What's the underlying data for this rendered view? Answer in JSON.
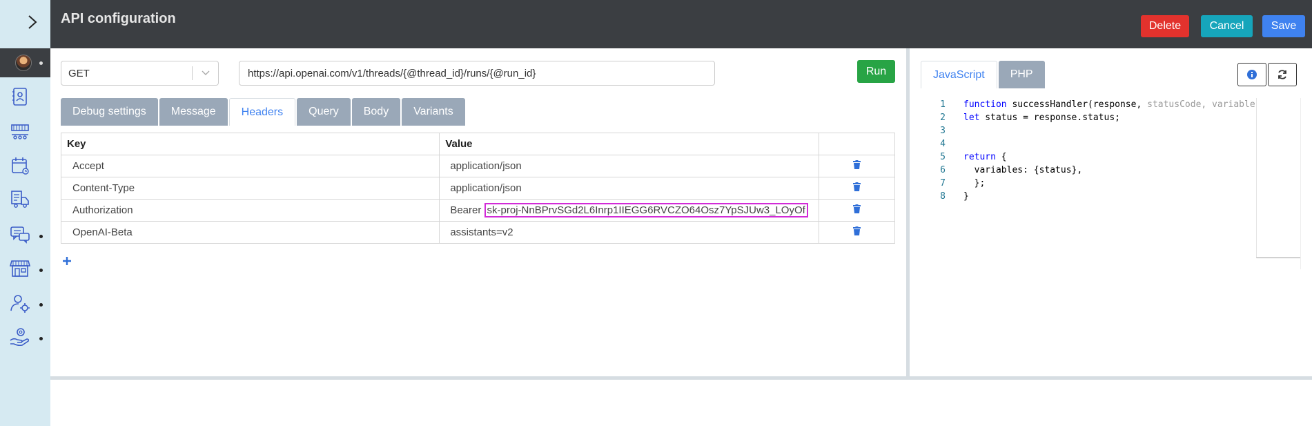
{
  "header": {
    "title": "API configuration",
    "delete_label": "Delete",
    "cancel_label": "Cancel",
    "save_label": "Save"
  },
  "sidebar": {
    "items": [
      {
        "icon": "contacts-icon"
      },
      {
        "icon": "conveyor-icon"
      },
      {
        "icon": "calendar-icon"
      },
      {
        "icon": "delivery-icon"
      },
      {
        "icon": "chat-icon"
      },
      {
        "icon": "store-icon"
      },
      {
        "icon": "user-settings-icon"
      },
      {
        "icon": "service-hand-icon"
      }
    ]
  },
  "request": {
    "method": "GET",
    "url": "https://api.openai.com/v1/threads/{@thread_id}/runs/{@run_id}",
    "run_label": "Run"
  },
  "tabs": [
    {
      "label": "Debug settings",
      "active": false
    },
    {
      "label": "Message",
      "active": false
    },
    {
      "label": "Headers",
      "active": true
    },
    {
      "label": "Query",
      "active": false
    },
    {
      "label": "Body",
      "active": false
    },
    {
      "label": "Variants",
      "active": false
    }
  ],
  "headers_table": {
    "columns": [
      "Key",
      "Value"
    ],
    "rows": [
      {
        "key": "Accept",
        "value": "application/json"
      },
      {
        "key": "Content-Type",
        "value": "application/json"
      },
      {
        "key": "Authorization",
        "value_prefix": "Bearer ",
        "value_secret": "sk-proj-NnBPrvSGd2L6Inrp1IIEGG6RVCZO64Osz7YpSJUw3_LOyOf"
      },
      {
        "key": "OpenAI-Beta",
        "value": "assistants=v2"
      }
    ]
  },
  "code": {
    "tabs": [
      {
        "label": "JavaScript",
        "active": true
      },
      {
        "label": "PHP",
        "active": false
      }
    ],
    "line_numbers": [
      "1",
      "2",
      "3",
      "4",
      "5",
      "6",
      "7",
      "8"
    ],
    "lines": [
      {
        "kw": "function",
        "text": " successHandler(response, ",
        "hint": "statusCode, variables,"
      },
      {
        "kw": "let",
        "text": " status = response.status;"
      },
      {
        "text": ""
      },
      {
        "text": ""
      },
      {
        "kw": "return",
        "text": " {"
      },
      {
        "text": "  variables: {status},"
      },
      {
        "text": "  };"
      },
      {
        "text": "}"
      }
    ]
  },
  "colors": {
    "topbar": "#3b3e42",
    "sidebar": "#d6eaf2",
    "accent": "#3f82f0",
    "delete": "#e2322d",
    "cancel": "#16a5bb",
    "run": "#28a445",
    "tab_inactive": "#9aa8b8",
    "highlight": "#d22bd8"
  }
}
